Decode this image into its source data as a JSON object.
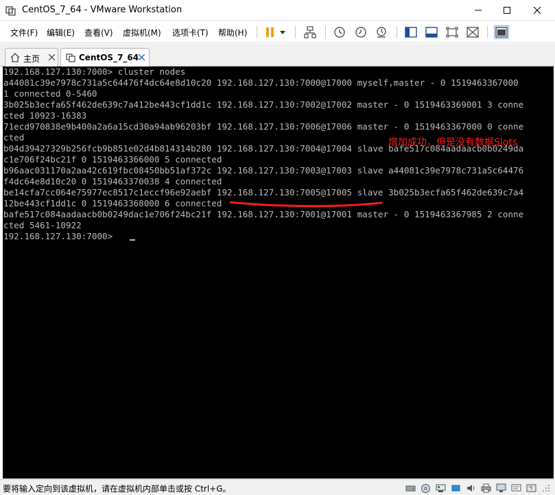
{
  "window": {
    "title": "CentOS_7_64 - VMware Workstation"
  },
  "menu": {
    "items": [
      {
        "label": "文件(F)"
      },
      {
        "label": "编辑(E)"
      },
      {
        "label": "查看(V)"
      },
      {
        "label": "虚拟机(M)"
      },
      {
        "label": "选项卡(T)"
      },
      {
        "label": "帮助(H)"
      }
    ]
  },
  "tabs": [
    {
      "label": "主页",
      "icon": "home-icon"
    },
    {
      "label": "CentOS_7_64",
      "icon": "vm-icon",
      "active": true
    }
  ],
  "console": {
    "lines": [
      "192.168.127.130:7000> cluster nodes",
      "a44081c39e7978c731a5c64476f4dc64e8d10c20 192.168.127.130:7000@17000 myself,master - 0 1519463367000",
      "1 connected 0-5460",
      "3b025b3ecfa65f462de639c7a412be443cf1dd1c 192.168.127.130:7002@17002 master - 0 1519463369001 3 conne",
      "cted 10923-16383",
      "71ecd970838e9b400a2a6a15cd30a94ab96203bf 192.168.127.130:7006@17006 master - 0 1519463367000 0 conne",
      "cted",
      "b04d39427329b256fcb9b851e02d4b814314b280 192.168.127.130:7004@17004 slave bafe517c084aadaacb0b0249da",
      "c1e706f24bc21f 0 1519463366000 5 connected",
      "b96aac031170a2aa42c619fbc08450bb51af372c 192.168.127.130:7003@17003 slave a44081c39e7978c731a5c64476",
      "f4dc64e8d10c20 0 1519463370038 4 connected",
      "be14cfa7cc064e75977ec8517c1eccf96e92aebf 192.168.127.130:7005@17005 slave 3b025b3ecfa65f462de639c7a4",
      "12be443cf1dd1c 0 1519463368000 6 connected",
      "bafe517c084aadaacb0b0249dac1e706f24bc21f 192.168.127.130:7001@17001 master - 0 1519463367985 2 conne",
      "cted 5461-10922",
      "192.168.127.130:7000> "
    ],
    "annotation": "增加成功，但是没有数据Slots",
    "annotation_color": "#ff1b1b"
  },
  "status": {
    "text": "要将输入定向到该虚拟机，请在虚拟机内部单击或按 Ctrl+G。"
  }
}
